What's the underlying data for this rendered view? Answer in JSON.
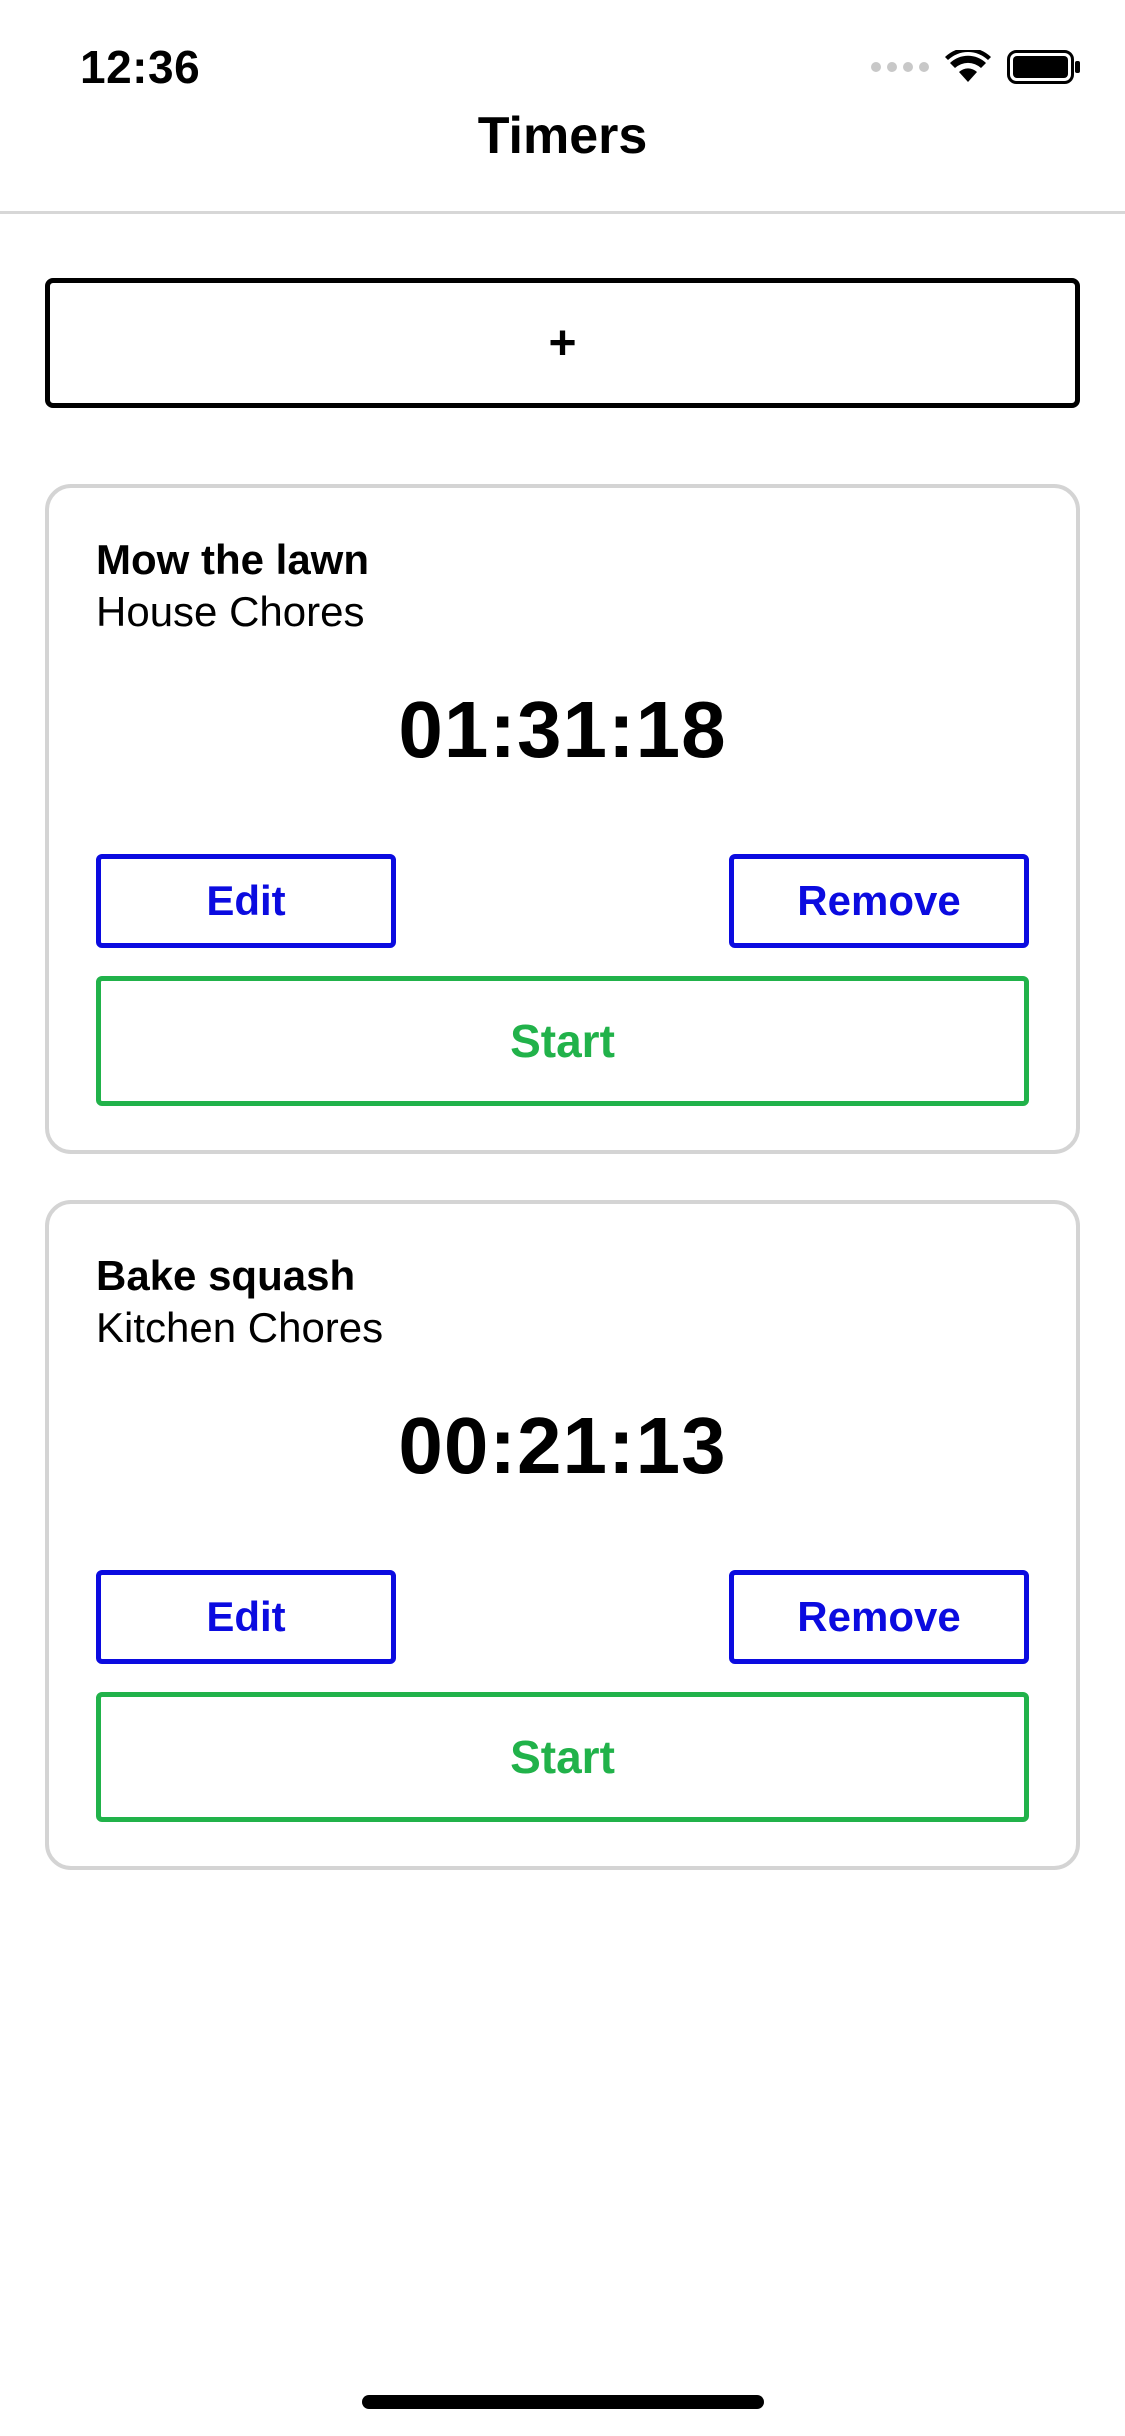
{
  "status_bar": {
    "time": "12:36",
    "icons": [
      "cellular-signal-icon",
      "wifi-icon",
      "battery-icon"
    ]
  },
  "nav": {
    "title": "Timers"
  },
  "add_button": {
    "label": "+"
  },
  "timers": [
    {
      "title": "Mow the lawn",
      "project": "House Chores",
      "elapsed": "01:31:18",
      "edit_label": "Edit",
      "remove_label": "Remove",
      "start_label": "Start"
    },
    {
      "title": "Bake squash",
      "project": "Kitchen Chores",
      "elapsed": "00:21:13",
      "edit_label": "Edit",
      "remove_label": "Remove",
      "start_label": "Start"
    }
  ],
  "colors": {
    "action_blue": "#0b0be0",
    "start_green": "#21b24a",
    "card_border": "#d4d4d4"
  }
}
